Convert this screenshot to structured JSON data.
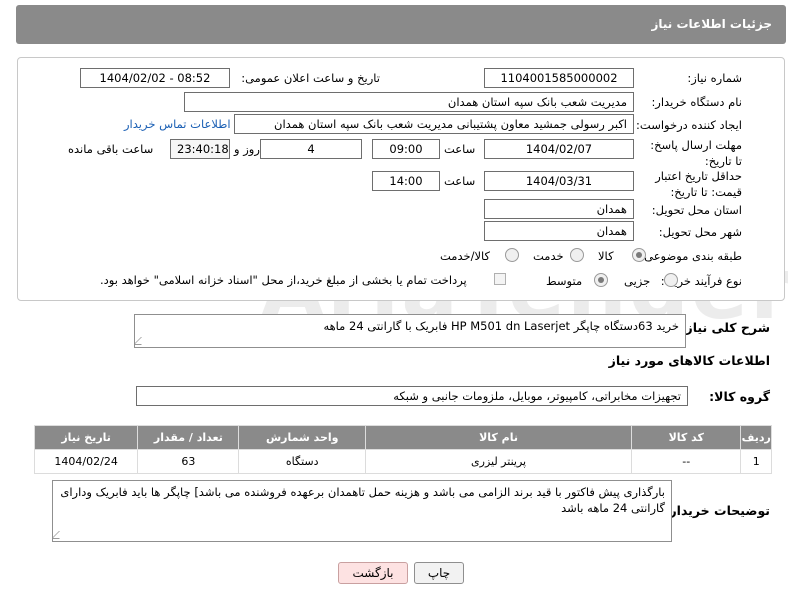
{
  "header": {
    "title": "جزئیات اطلاعات نیاز"
  },
  "fields": {
    "need_number_label": "شماره نیاز:",
    "need_number": "1104001585000002",
    "announce_label": "تاریخ و ساعت اعلان عمومی:",
    "announce_value": "1404/02/02 - 08:52",
    "buyer_org_label": "نام دستگاه خریدار:",
    "buyer_org": "مدیریت شعب بانک سپه استان همدان",
    "creator_label": "ایجاد کننده درخواست:",
    "creator": "اکبر رسولی جمشید معاون پشتیبانی مدیریت شعب بانک سپه استان همدان",
    "contact_link": "اطلاعات تماس خریدار",
    "reply_deadline_label": "مهلت ارسال پاسخ: تا تاریخ:",
    "reply_date": "1404/02/07",
    "time_label": "ساعت",
    "reply_time": "09:00",
    "days_value": "4",
    "days_label": "روز و",
    "remaining_time": "23:40:18",
    "remaining_label": "ساعت باقی مانده",
    "price_validity_label": "حداقل تاریخ اعتبار قیمت: تا تاریخ:",
    "price_date": "1404/03/31",
    "price_time": "14:00",
    "province_label": "استان محل تحویل:",
    "province": "همدان",
    "city_label": "شهر محل تحویل:",
    "city": "همدان",
    "category_label": "طبقه بندی موضوعی:",
    "category_options": [
      "کالا",
      "خدمت",
      "کالا/خدمت"
    ],
    "process_label": "نوع فرآیند خرید :",
    "process_options": [
      "جزیی",
      "متوسط"
    ],
    "payment_note": "پرداخت تمام یا بخشی از مبلغ خرید،از محل \"اسناد خزانه اسلامی\" خواهد بود."
  },
  "description": {
    "label": "شرح کلی نیاز:",
    "text": "خرید 63دستگاه چاپگر HP M501 dn Laserjet  فابریک با گارانتی 24 ماهه"
  },
  "goods_section": {
    "title": "اطلاعات کالاهای مورد نیاز",
    "group_label": "گروه کالا:",
    "group_value": "تجهیزات مخابراتی، کامپیوتر، موبایل، ملزومات جانبی و شبکه"
  },
  "table": {
    "headers": [
      "ردیف",
      "کد کالا",
      "نام کالا",
      "واحد شمارش",
      "تعداد / مقدار",
      "تاریخ نیاز"
    ],
    "rows": [
      [
        "1",
        "--",
        "پرینتر لیزری",
        "دستگاه",
        "63",
        "1404/02/24"
      ]
    ]
  },
  "buyer_notes": {
    "label": "توضیحات خریدار:",
    "text": "بارگذاری پیش فاکتور با قید برند الزامی می باشد و هزینه حمل تاهمدان برعهده فروشنده می باشد] چاپگر ها باید فابریک ودارای گارانتی 24 ماهه باشد"
  },
  "buttons": {
    "print": "چاپ",
    "back": "بازگشت"
  },
  "watermark": "AriaTender.neT",
  "colors": {
    "header_bg": "#8a8a8a",
    "link": "#1a5fb4",
    "back_btn_bg": "#fde2e2"
  }
}
